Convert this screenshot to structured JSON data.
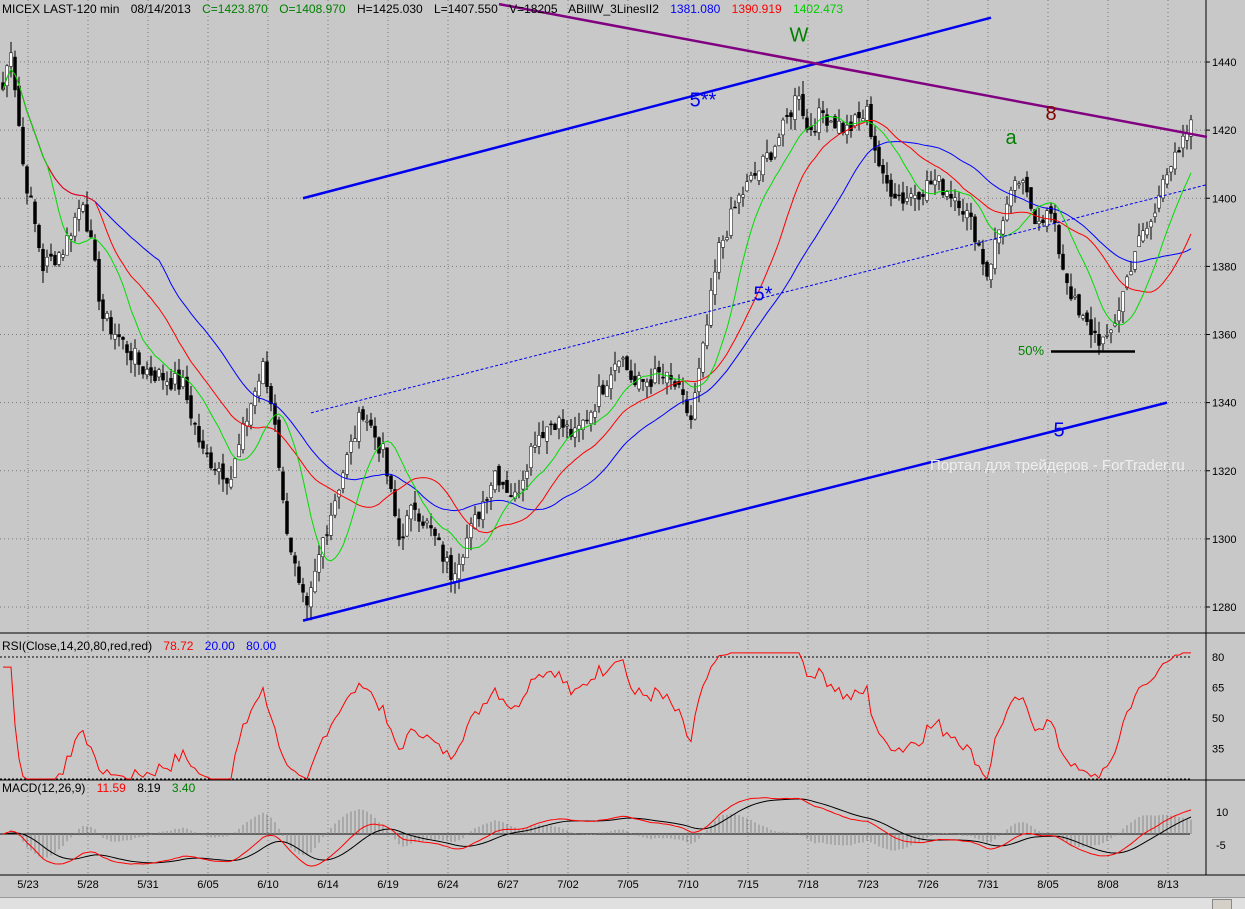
{
  "header": {
    "symbol": "MICEX LAST-120 min",
    "date": "08/14/2013",
    "close": "C=1423.870",
    "open": "O=1408.970",
    "high": "H=1425.030",
    "low": "L=1407.550",
    "volume": "V=18205",
    "indicator": "ABillW_3LinesII2",
    "v1": "1381.080",
    "v2": "1390.919",
    "v3": "1402.473"
  },
  "rsi_header": {
    "label": "RSI(Close,14,20,80,red,red)",
    "value": "78.72",
    "low": "20.00",
    "high": "80.00"
  },
  "macd_header": {
    "label": "MACD(12,26,9)",
    "macd": "11.59",
    "signal": "8.19",
    "hist": "3.40"
  },
  "watermark": "Портал для трейдеров - ForTrader.ru",
  "colors": {
    "bg": "#c8c8c8",
    "bull": "#ffffff",
    "bear": "#000000",
    "ma_slow": "#0000ff",
    "ma_mid": "#ff0000",
    "ma_fast": "#00dd00",
    "trend": "#0000ee",
    "resistance": "#800080"
  },
  "chart_data": {
    "type": "candlestick",
    "title": "MICEX LAST-120 min",
    "y_ticks": [
      1280,
      1300,
      1320,
      1340,
      1360,
      1380,
      1400,
      1420,
      1440
    ],
    "ylim": [
      1268,
      1457
    ],
    "x_ticks": [
      "5/23",
      "5/28",
      "5/31",
      "6/05",
      "6/10",
      "6/14",
      "6/19",
      "6/24",
      "6/27",
      "7/02",
      "7/05",
      "7/10",
      "7/15",
      "7/18",
      "7/23",
      "7/26",
      "7/31",
      "8/05",
      "8/08",
      "8/13"
    ],
    "bars_per_tick": 15,
    "close_path": [
      [
        0,
        1432
      ],
      [
        2,
        1445
      ],
      [
        5,
        1410
      ],
      [
        10,
        1380
      ],
      [
        15,
        1385
      ],
      [
        20,
        1400
      ],
      [
        25,
        1365
      ],
      [
        35,
        1350
      ],
      [
        45,
        1345
      ],
      [
        50,
        1325
      ],
      [
        57,
        1318
      ],
      [
        62,
        1340
      ],
      [
        65,
        1350
      ],
      [
        68,
        1335
      ],
      [
        70,
        1310
      ],
      [
        74,
        1285
      ],
      [
        76,
        1278
      ],
      [
        80,
        1300
      ],
      [
        85,
        1320
      ],
      [
        90,
        1338
      ],
      [
        95,
        1325
      ],
      [
        99,
        1300
      ],
      [
        103,
        1310
      ],
      [
        108,
        1300
      ],
      [
        112,
        1290
      ],
      [
        118,
        1305
      ],
      [
        123,
        1320
      ],
      [
        128,
        1312
      ],
      [
        133,
        1330
      ],
      [
        138,
        1335
      ],
      [
        143,
        1330
      ],
      [
        148,
        1340
      ],
      [
        154,
        1355
      ],
      [
        158,
        1345
      ],
      [
        164,
        1348
      ],
      [
        168,
        1345
      ],
      [
        172,
        1335
      ],
      [
        175,
        1355
      ],
      [
        179,
        1385
      ],
      [
        184,
        1400
      ],
      [
        190,
        1410
      ],
      [
        195,
        1420
      ],
      [
        199,
        1432
      ],
      [
        201,
        1420
      ],
      [
        205,
        1425
      ],
      [
        211,
        1420
      ],
      [
        216,
        1425
      ],
      [
        220,
        1405
      ],
      [
        225,
        1400
      ],
      [
        233,
        1405
      ],
      [
        239,
        1400
      ],
      [
        243,
        1390
      ],
      [
        246,
        1378
      ],
      [
        250,
        1395
      ],
      [
        254,
        1405
      ],
      [
        258,
        1395
      ],
      [
        262,
        1395
      ],
      [
        265,
        1380
      ],
      [
        269,
        1365
      ],
      [
        273,
        1360
      ],
      [
        276,
        1357
      ],
      [
        279,
        1368
      ],
      [
        283,
        1385
      ],
      [
        288,
        1395
      ],
      [
        290,
        1408
      ],
      [
        294,
        1412
      ],
      [
        297,
        1423
      ]
    ],
    "ma_periods": [
      40,
      24,
      12
    ],
    "trendlines": [
      {
        "name": "upper-channel",
        "from": [
          75,
          1400
        ],
        "to": [
          247,
          1453
        ],
        "style": "solid",
        "color": "#0000ee"
      },
      {
        "name": "lower-channel",
        "from": [
          75,
          1276
        ],
        "to": [
          291,
          1340
        ],
        "style": "solid",
        "color": "#0000ee"
      },
      {
        "name": "mid-channel",
        "from": [
          77,
          1337
        ],
        "to": [
          301,
          1404
        ],
        "style": "dotted",
        "color": "#0000ee"
      },
      {
        "name": "resistance",
        "from": [
          124,
          1457
        ],
        "to": [
          301,
          1418
        ],
        "style": "solid",
        "color": "#800080"
      },
      {
        "name": "support-50",
        "from": [
          262,
          1355
        ],
        "to": [
          283,
          1355
        ],
        "style": "solid",
        "color": "#000000"
      }
    ],
    "annotations": [
      {
        "text": "W",
        "at": [
          199,
          1446
        ],
        "color": "#008000"
      },
      {
        "text": "5**",
        "at": [
          175,
          1427
        ],
        "color": "#0000ee"
      },
      {
        "text": "8",
        "at": [
          262,
          1423
        ],
        "color": "#800000"
      },
      {
        "text": "a",
        "at": [
          252,
          1416
        ],
        "color": "#008000"
      },
      {
        "text": "5*",
        "at": [
          190,
          1370
        ],
        "color": "#0000ee"
      },
      {
        "text": "50%",
        "at": [
          257,
          1354
        ],
        "color": "#008000"
      },
      {
        "text": "5",
        "at": [
          264,
          1330
        ],
        "color": "#0000ee"
      }
    ],
    "rsi": {
      "period": 14,
      "levels": [
        20,
        80
      ],
      "ticks": [
        80,
        65,
        50,
        35
      ],
      "last": 78.72
    },
    "macd": {
      "fast": 12,
      "slow": 26,
      "signal": 9,
      "ticks": [
        10,
        -5
      ],
      "last": 11.59,
      "signal_last": 8.19,
      "hist_last": 3.4
    }
  }
}
